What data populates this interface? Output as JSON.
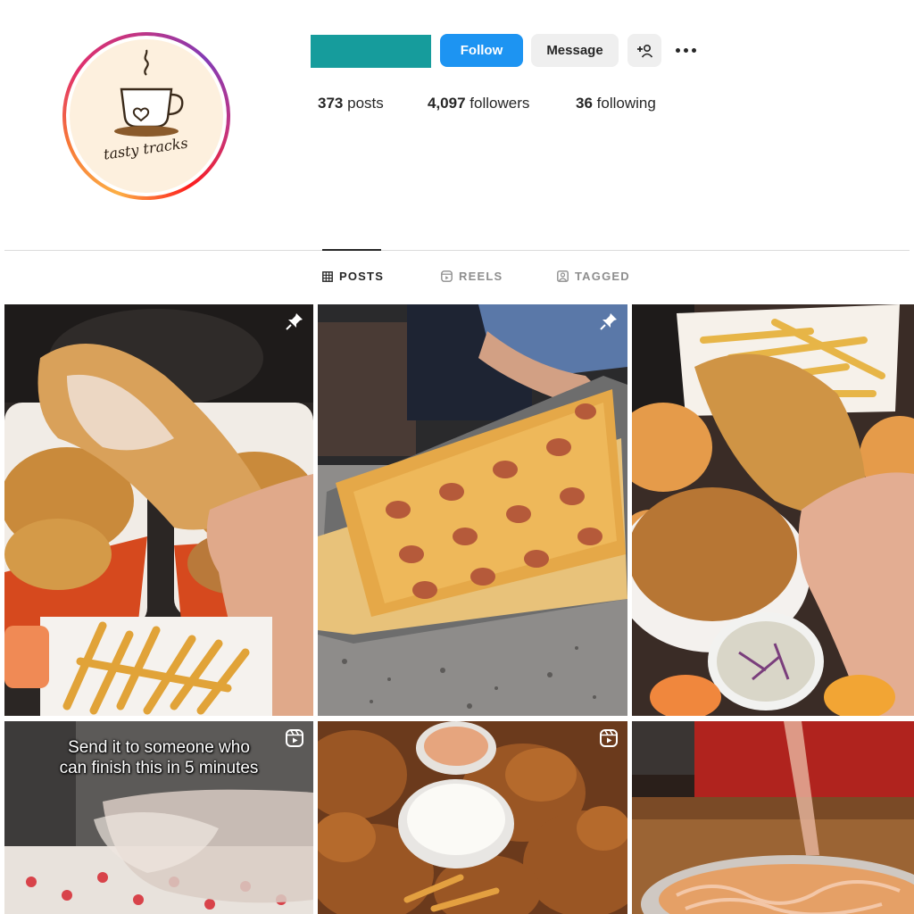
{
  "profile": {
    "logo_text": "tasty tracks",
    "buttons": {
      "follow": "Follow",
      "message": "Message"
    },
    "stats": {
      "posts_count": "373",
      "posts_label": "posts",
      "followers_count": "4,097",
      "followers_label": "followers",
      "following_count": "36",
      "following_label": "following"
    }
  },
  "tabs": [
    {
      "label": "POSTS",
      "icon": "grid-icon",
      "active": true
    },
    {
      "label": "REELS",
      "icon": "reels-icon",
      "active": false
    },
    {
      "label": "TAGGED",
      "icon": "tagged-icon",
      "active": false
    }
  ],
  "grid": {
    "posts": [
      {
        "subject": "fried chicken tenders, buckets and fries",
        "badge": "pin-icon"
      },
      {
        "subject": "pepperoni cheese fries tray",
        "badge": "pin-icon"
      },
      {
        "subject": "fried chicken, buns, fries and coleslaw",
        "badge": null
      },
      {
        "subject": "reel with caption",
        "badge": "reels-icon",
        "caption_line1": "Send it to someone who",
        "caption_line2": "can finish this in 5 minutes"
      },
      {
        "subject": "fried chicken with dipping sauces",
        "badge": "reels-icon"
      },
      {
        "subject": "loaded fries with sauce drizzle",
        "badge": null
      }
    ]
  },
  "colors": {
    "follow_button": "#1d94f2",
    "secondary_button": "#efefef",
    "username_placeholder": "#169c9c",
    "text": "#262626",
    "muted": "#8e8e8e"
  }
}
